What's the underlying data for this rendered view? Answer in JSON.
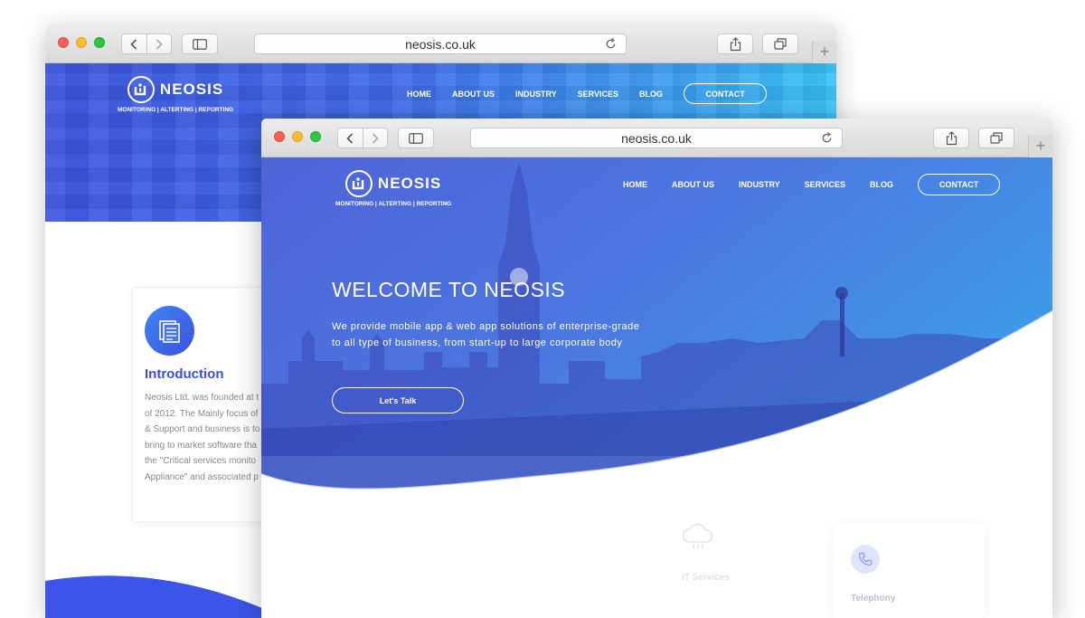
{
  "colors": {
    "brand_blue": "#3a4ee0",
    "hero_start": "#3c55e0",
    "hero_end": "#37c3f7",
    "text_muted": "#888888"
  },
  "back_window": {
    "url": "neosis.co.uk",
    "logo": {
      "name": "NEOSIS",
      "tagline": "MONITORING | ALTERTING | REPORTING"
    },
    "nav": {
      "items": [
        "HOME",
        "ABOUT US",
        "INDUSTRY",
        "SERVICES",
        "BLOG"
      ],
      "contact": "CONTACT"
    },
    "intro": {
      "title": "Introduction",
      "lines": [
        "Neosis Ltd. was founded at t",
        "of 2012. The Mainly focus of",
        "& Support and business is to",
        "bring to market software tha",
        "the \"Critical services monito",
        "Appliance\" and associated p"
      ]
    }
  },
  "front_window": {
    "url": "neosis.co.uk",
    "logo": {
      "name": "NEOSIS",
      "tagline": "MONITORING | ALTERTING | REPORTING"
    },
    "nav": {
      "items": [
        "HOME",
        "ABOUT US",
        "INDUSTRY",
        "SERVICES",
        "BLOG"
      ],
      "contact": "CONTACT"
    },
    "hero": {
      "title": "WELCOME TO NEOSIS",
      "lead": "We provide mobile app & web app solutions of enterprise-grade to all type of business, from start-up to large corporate body",
      "cta": "Let's Talk"
    },
    "services": [
      {
        "label": "IT Services",
        "icon": "cloud-icon"
      },
      {
        "label": "Telephony",
        "icon": "phone-icon"
      }
    ]
  }
}
